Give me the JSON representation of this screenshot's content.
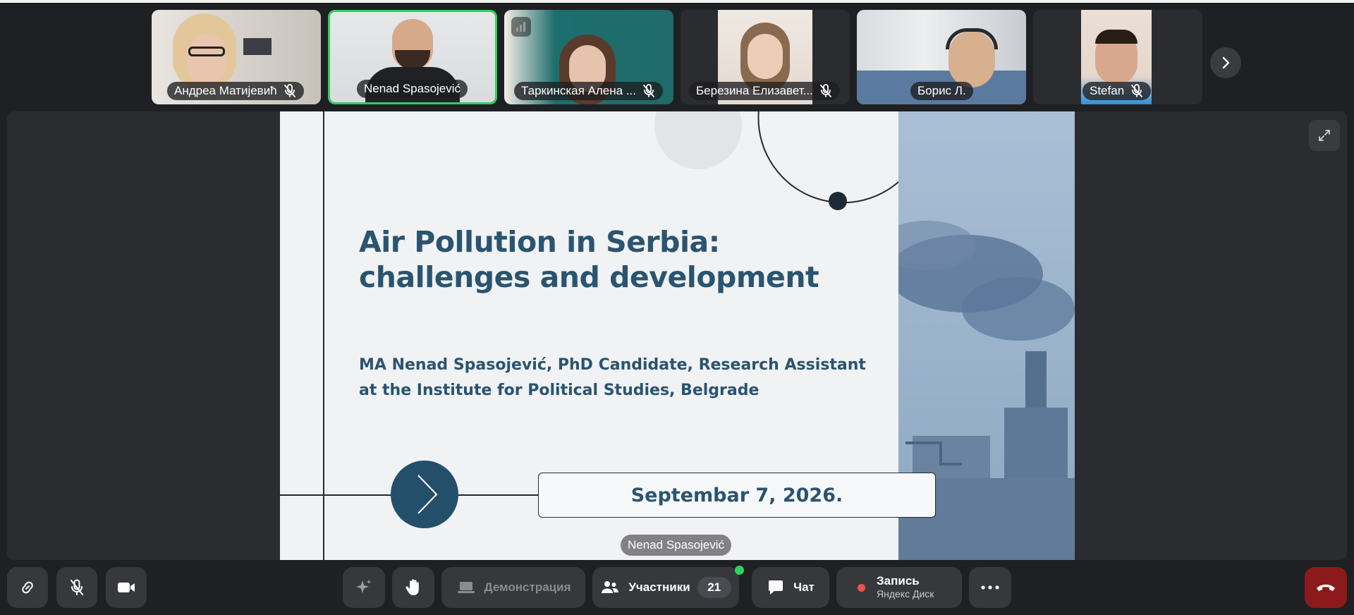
{
  "participants": [
    {
      "name": "Андреа Матијевић",
      "muted": true,
      "active": false
    },
    {
      "name": "Nenad Spasojević",
      "muted": false,
      "active": true
    },
    {
      "name": "Таркинская Алена ...",
      "muted": true,
      "active": false
    },
    {
      "name": "Березина Елизавет...",
      "muted": true,
      "active": false
    },
    {
      "name": "Борис Л.",
      "muted": false,
      "active": false
    },
    {
      "name": "Stefan",
      "muted": true,
      "active": false
    }
  ],
  "slide": {
    "title_line1": "Air Pollution in Serbia:",
    "title_line2": "challenges and development",
    "author_line1": "MA Nenad Spasojević, PhD Candidate, Research Assistant",
    "author_line2": "at the Institute for Political Studies, Belgrade",
    "date": "Septembar 7, 2026.",
    "accent_color": "#2a5470",
    "arrow_circle_color": "#234f6b"
  },
  "presenter_label": "Nenad Spasojević",
  "toolbar": {
    "demo_label": "Демонстрация",
    "participants_label": "Участники",
    "participants_count": "21",
    "chat_label": "Чат",
    "record_label": "Запись",
    "record_sub": "Яндекс Диск"
  },
  "colors": {
    "background": "#1f2023",
    "tile": "#2b2c30",
    "button": "#37383c",
    "active_speaker": "#2fd15b",
    "end_call": "#8c1a1a",
    "record_dot": "#ef5350"
  }
}
